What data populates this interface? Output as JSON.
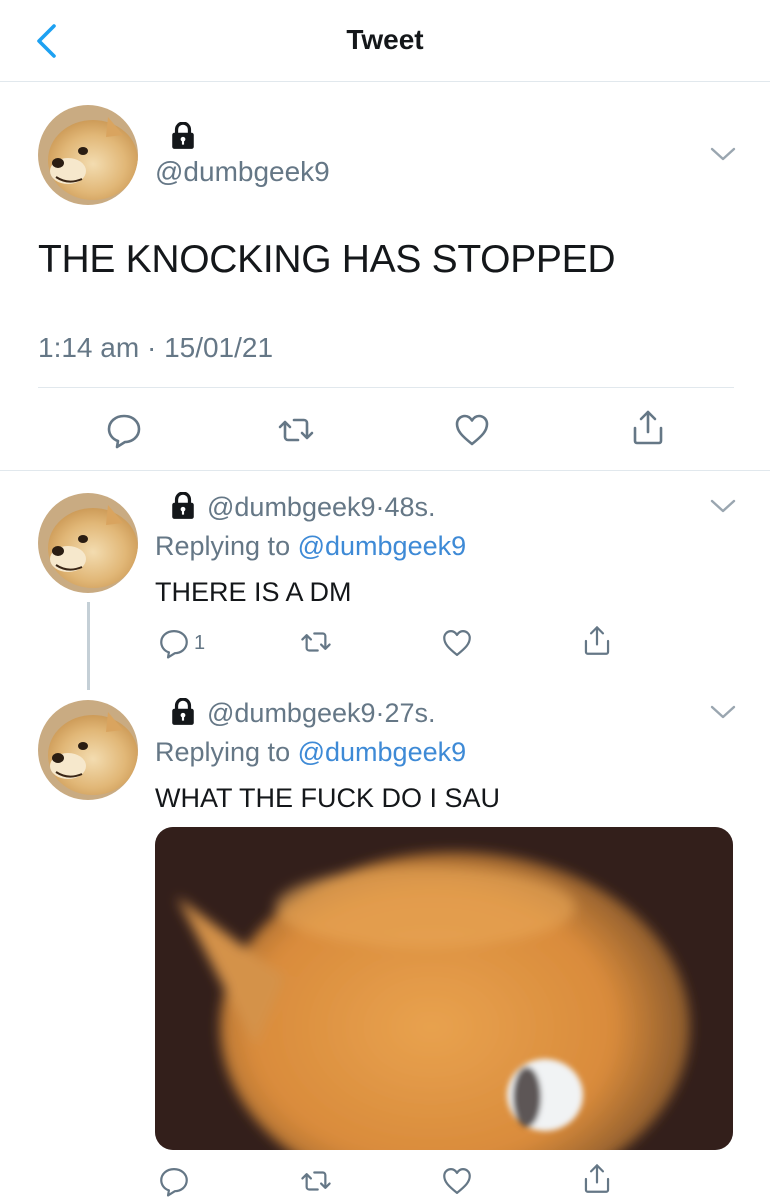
{
  "header": {
    "title": "Tweet"
  },
  "main_tweet": {
    "handle": "@dumbgeek9",
    "text": "THE KNOCKING HAS STOPPED",
    "time": "1:14 am",
    "separator": "·",
    "date": "15/01/21"
  },
  "replies": [
    {
      "handle": "@dumbgeek9",
      "age": "48s.",
      "replying_prefix": "Replying to",
      "replying_handle": "@dumbgeek9",
      "text": "THERE IS A DM",
      "reply_count": "1"
    },
    {
      "handle": "@dumbgeek9",
      "age": "27s.",
      "replying_prefix": "Replying to",
      "replying_handle": "@dumbgeek9",
      "text": "WHAT THE FUCK DO I SAU"
    }
  ],
  "colors": {
    "accent": "#1da1f2",
    "link": "#3e8ad6",
    "secondary_text": "#657786",
    "divider": "#e1e8ed"
  },
  "icons": [
    "back-chevron-icon",
    "lock-icon",
    "chevron-down-icon",
    "reply-icon",
    "retweet-icon",
    "like-icon",
    "share-icon"
  ]
}
